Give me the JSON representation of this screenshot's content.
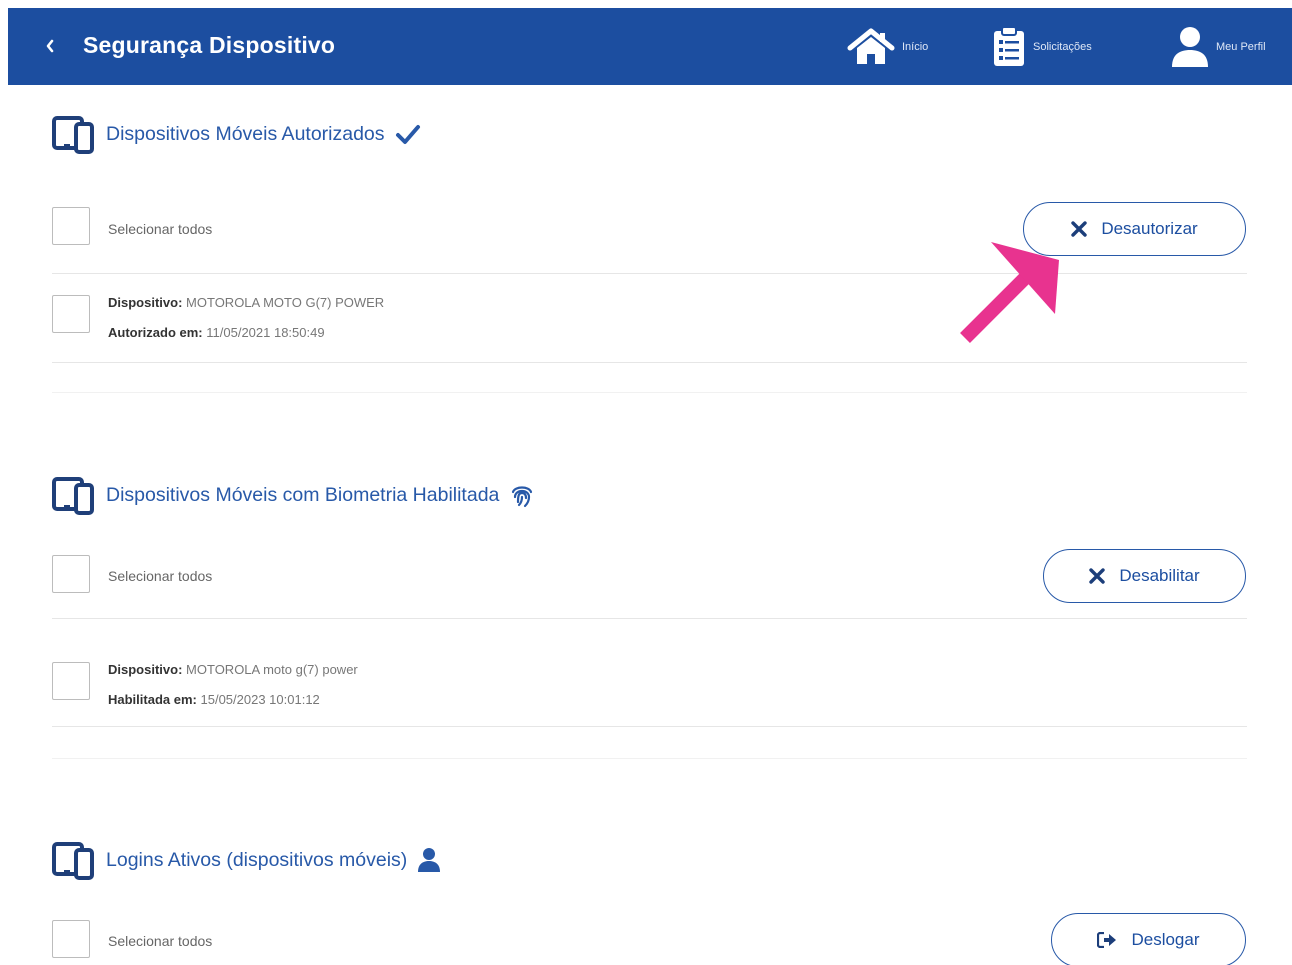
{
  "header": {
    "title": "Segurança Dispositivo",
    "nav": [
      {
        "label": "Início",
        "icon": "home-icon"
      },
      {
        "label": "Solicitações",
        "icon": "clipboard-icon"
      },
      {
        "label": "Meu Perfil",
        "icon": "user-icon"
      }
    ]
  },
  "sections": {
    "authorized": {
      "title": "Dispositivos Móveis Autorizados",
      "select_all": "Selecionar todos",
      "action_label": "Desautorizar",
      "item": {
        "device_label": "Dispositivo",
        "device_value": "MOTOROLA MOTO G(7) POWER",
        "date_label": "Autorizado em",
        "date_value": "11/05/2021 18:50:49"
      }
    },
    "biometric": {
      "title": "Dispositivos Móveis com Biometria Habilitada",
      "select_all": "Selecionar todos",
      "action_label": "Desabilitar",
      "item": {
        "device_label": "Dispositivo",
        "device_value": "MOTOROLA moto g(7) power",
        "date_label": "Habilitada em",
        "date_value": "15/05/2023 10:01:12"
      }
    },
    "logins": {
      "title": "Logins Ativos (dispositivos móveis)",
      "select_all": "Selecionar todos",
      "action_label": "Deslogar"
    }
  },
  "colors": {
    "header_bg": "#1c4ea0",
    "primary": "#2859a8",
    "annotation_arrow": "#e8338f"
  }
}
